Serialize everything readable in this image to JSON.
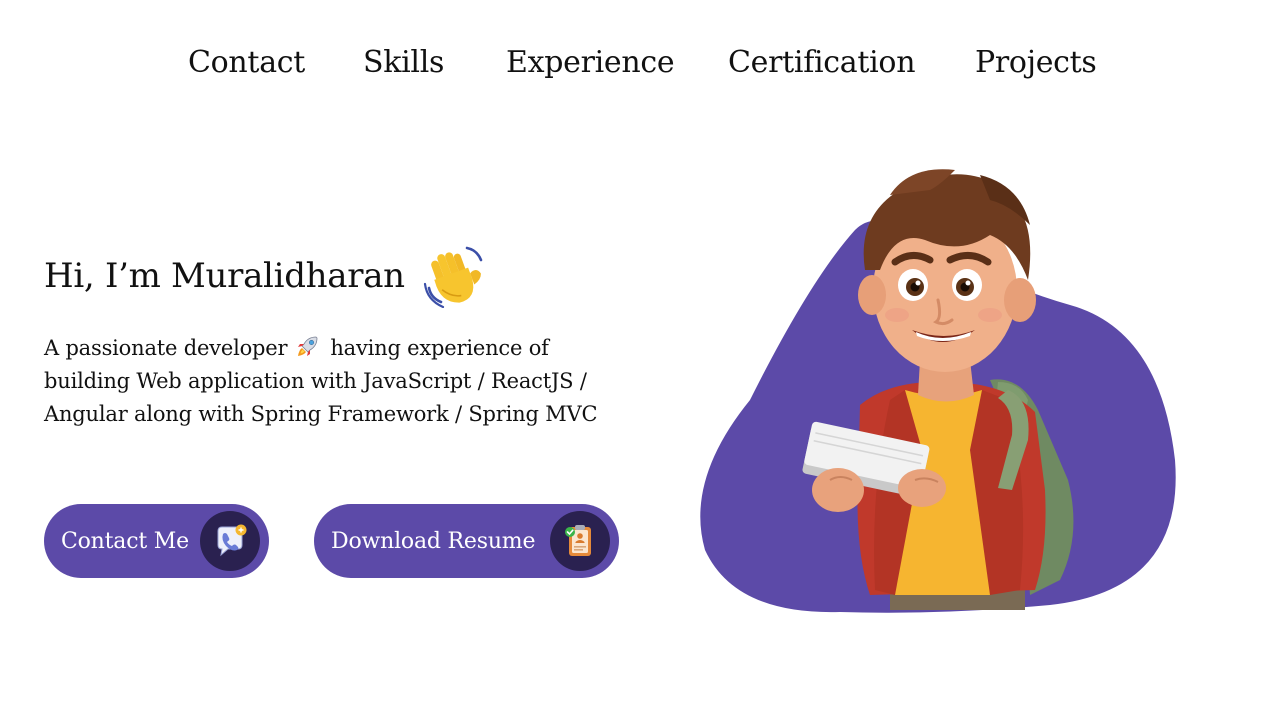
{
  "nav": {
    "items": [
      {
        "label": "Contact"
      },
      {
        "label": "Skills"
      },
      {
        "label": "Experience"
      },
      {
        "label": "Certification"
      },
      {
        "label": "Projects"
      }
    ]
  },
  "hero": {
    "greeting": "Hi, I’m Muralidharan",
    "greeting_icon": "waving-hand-icon",
    "description": {
      "line1_before_icon": "A passionate developer",
      "line1_icon": "rocket-icon",
      "line1_after_icon": "having experience of",
      "line2": "building Web application with JavaScript / ReactJS /",
      "line3": "Angular along with Spring Framework / Spring MVC"
    },
    "illustration": "cartoon-student-with-book-and-backpack"
  },
  "buttons": {
    "contact": {
      "label": "Contact Me",
      "icon": "speech-bubble-icon"
    },
    "resume": {
      "label": "Download Resume",
      "icon": "clipboard-document-icon"
    }
  },
  "colors": {
    "accent": "#5c4aa8",
    "icon_circle": "#2a2150",
    "text": "#111111",
    "background": "#ffffff"
  }
}
